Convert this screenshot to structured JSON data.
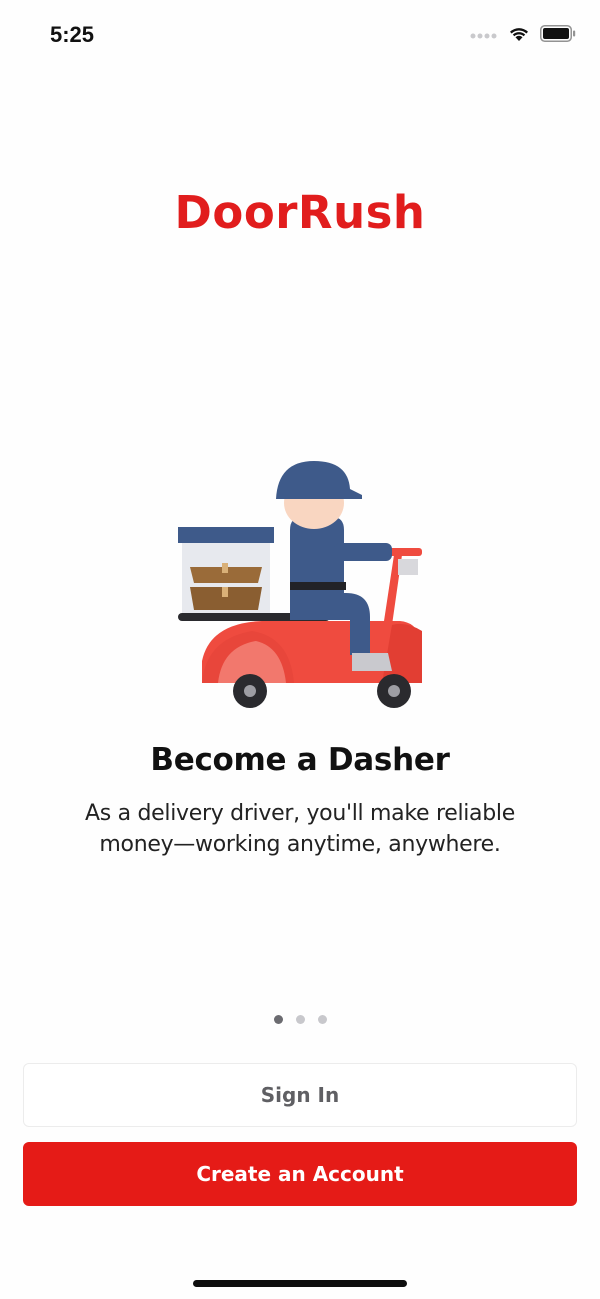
{
  "status_bar": {
    "time": "5:25",
    "icons": [
      "cellular-dots-icon",
      "wifi-icon",
      "battery-icon"
    ]
  },
  "brand": {
    "name": "DoorRush",
    "color": "#e11d1d"
  },
  "onboarding": {
    "illustration": "delivery-scooter-illustration",
    "title": "Become a Dasher",
    "description": "As a delivery driver, you'll make reliable money—working anytime, anywhere.",
    "page_indicator": {
      "total": 3,
      "active_index": 0
    }
  },
  "actions": {
    "sign_in_label": "Sign In",
    "create_account_label": "Create an Account",
    "primary_color": "#e51b17"
  }
}
